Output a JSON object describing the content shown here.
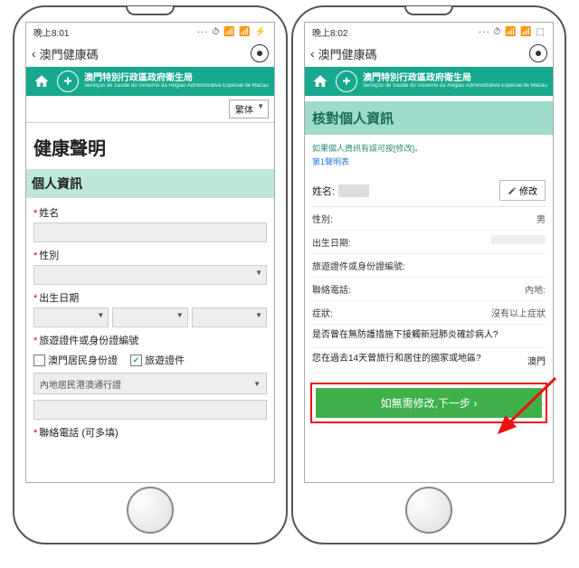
{
  "status_left": {
    "time": "晚上8:01",
    "icons": "··· ⏱ 📶 📶 ⚡"
  },
  "status_right": {
    "time": "晚上8:02",
    "icons": "··· ⏱ 📶 📶 ⬚"
  },
  "navbar": {
    "title": "澳門健康碼"
  },
  "org": {
    "line1": "澳門特別行政區政府衛生局",
    "line2": "Serviços de Saúde do Governo da Região Administrativa Especial de Macau"
  },
  "lang": {
    "selected": "繁体"
  },
  "left": {
    "heading": "健康聲明",
    "section": "個人資訊",
    "name_label": "姓名",
    "gender_label": "性別",
    "dob_label": "出生日期",
    "doc_label": "旅遊證件或身份證編號",
    "cb_local": "澳門居民身份證",
    "cb_travel": "旅遊證件",
    "permit_placeholder": "內地居民港澳通行證",
    "phone_label": "聯絡電話 (可多填)"
  },
  "right": {
    "review_title": "核對個人資訊",
    "hint": "如果個人資訊有誤可按[修改]。",
    "link": "第1聲明表",
    "name_label": "姓名:",
    "edit": "修改",
    "gender_k": "性別:",
    "gender_v": "男",
    "dob_k": "出生日期:",
    "doc_k": "旅遊證件或身份證編號:",
    "phone_k": "聯絡電話:",
    "phone_v": "內地:",
    "sym_k": "症狀:",
    "sym_v": "沒有以上症狀",
    "q1": "是否曾在無防護措施下接觸新冠肺炎確診病人?",
    "q2": "您在過去14天曾旅行和居住的國家或地區?",
    "q2_v": "澳門",
    "cta": "如無需修改,下一步 ›"
  }
}
